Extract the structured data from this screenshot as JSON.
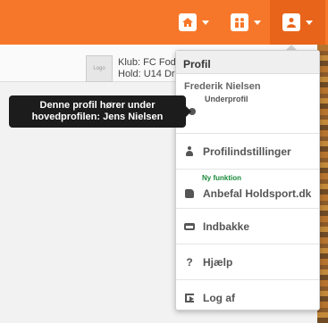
{
  "topbar": {
    "accent": "#f7772a",
    "icons": [
      "home-icon",
      "team-icon",
      "profile-icon"
    ]
  },
  "club": {
    "logo_text": "Logo",
    "club_line": "Klub: FC Fodt",
    "team_line": "Hold: U14 Dr"
  },
  "dropdown": {
    "header": "Profil",
    "profile_name": "Frederik Nielsen",
    "profile_sub": "Underprofil",
    "items": [
      {
        "label": "Profilindstillinger",
        "icon": "user-icon"
      },
      {
        "label": "Anbefal Holdsport.dk",
        "icon": "thumbs-up-icon",
        "tag": "Ny funktion"
      },
      {
        "label": "Indbakke",
        "icon": "inbox-icon"
      },
      {
        "label": "Hjælp",
        "icon": "help-icon",
        "glyph": "?"
      },
      {
        "label": "Log af",
        "icon": "sign-out-icon"
      }
    ]
  },
  "tooltip": {
    "line1": "Denne profil hører under",
    "line2": "hovedprofilen: Jens Nielsen"
  }
}
